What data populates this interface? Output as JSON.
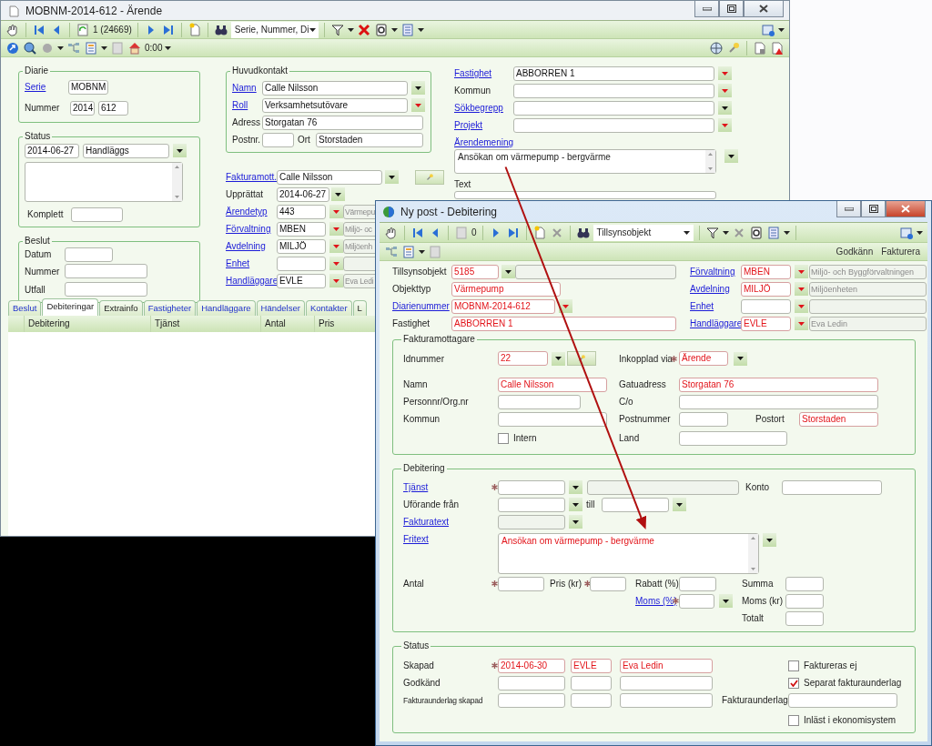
{
  "arende_window": {
    "title": "MOBNM-2014-612 - Ärende",
    "toolbar": {
      "record": "1 (24669)",
      "search": "Serie, Nummer, Di",
      "time": "0:00"
    },
    "diarie": {
      "legend": "Diarie",
      "fields": [
        {
          "label": "Serie",
          "link": true,
          "values": [
            "MOBNM"
          ]
        },
        {
          "label": "Nummer",
          "link": false,
          "values": [
            "2014",
            "612"
          ]
        }
      ]
    },
    "status": {
      "legend": "Status",
      "date": "2014-06-27",
      "state": "Handläggs",
      "komplett": "Komplett"
    },
    "beslut": {
      "legend": "Beslut",
      "fields": [
        {
          "label": "Datum",
          "link": false
        },
        {
          "label": "Nummer",
          "link": false
        },
        {
          "label": "Utfall",
          "link": false
        }
      ]
    },
    "huvudkontakt": {
      "legend": "Huvudkontakt",
      "fields": [
        {
          "label": "Namn",
          "link": true,
          "value": "Calle Nilsson",
          "arrow_required": false
        },
        {
          "label": "Roll",
          "link": true,
          "value": "Verksamhetsutövare",
          "arrow_required": true
        },
        {
          "label": "Adress",
          "link": false,
          "value": "Storgatan 76"
        },
        {
          "label": "Postnr.",
          "link": false
        },
        {
          "label": "Ort",
          "link": false,
          "value": "Storstaden"
        }
      ]
    },
    "case_fields": [
      {
        "label": "Fakturamott.",
        "link": true,
        "value": "Calle Nilsson",
        "arrow_required": false,
        "lookup": true
      },
      {
        "label": "Upprättat",
        "link": false,
        "value": "2014-06-27",
        "arrow_required": false
      },
      {
        "label": "Ärendetyp",
        "link": true,
        "value": "443",
        "arrow_required": true,
        "companion": true,
        "note": "Värmepu"
      },
      {
        "label": "Förvaltning",
        "link": true,
        "value": "MBEN",
        "arrow_required": true,
        "companion": true,
        "note": "Miljö- oc"
      },
      {
        "label": "Avdelning",
        "link": true,
        "value": "MILJÖ",
        "arrow_required": true,
        "companion": true,
        "note": "Miljöenh"
      },
      {
        "label": "Enhet",
        "link": true,
        "arrow_required": true,
        "companion": true
      },
      {
        "label": "Handläggare",
        "link": true,
        "value": "EVLE",
        "arrow_required": true,
        "companion": true,
        "note": "Eva Ledi"
      }
    ],
    "property_fields": [
      {
        "label": "Fastighet",
        "link": true,
        "value": "ABBORREN 1",
        "arrow_required": true
      },
      {
        "label": "Kommun",
        "link": false,
        "arrow_required": true
      },
      {
        "label": "Sökbegrepp",
        "link": true,
        "arrow_required": false
      },
      {
        "label": "Projekt",
        "link": true,
        "arrow_required": true
      }
    ],
    "arendemening": {
      "label": "Ärendemening",
      "link": true,
      "value": "Ansökan om värmepump - bergvärme",
      "arrow_required": false
    },
    "text_label": "Text",
    "tabs": [
      {
        "label": "Beslut",
        "has_data": true,
        "selected": false
      },
      {
        "label": "Debiteringar",
        "has_data": false,
        "selected": true
      },
      {
        "label": "Extrainfo",
        "has_data": false,
        "selected": false
      },
      {
        "label": "Fastigheter",
        "has_data": true,
        "selected": false
      },
      {
        "label": "Handläggare",
        "has_data": true,
        "selected": false
      },
      {
        "label": "Händelser",
        "has_data": true,
        "selected": false
      },
      {
        "label": "Kontakter",
        "has_data": true,
        "selected": false
      },
      {
        "label": "L",
        "has_data": false,
        "selected": false
      }
    ],
    "table": {
      "columns": [
        "Debitering",
        "Tjänst",
        "Antal",
        "Pris"
      ]
    }
  },
  "debitering_window": {
    "title": "Ny post - Debitering",
    "toolbar": {
      "record": "0",
      "search": "Tillsynsobjekt",
      "actions": [
        "Godkänn",
        "Fakturera"
      ]
    },
    "object_fields": [
      {
        "label": "Tillsynsobjekt",
        "link": false,
        "value": "5185",
        "required": true,
        "arrow_required": false,
        "companion": true
      },
      {
        "label": "Objekttyp",
        "link": false,
        "value": "Värmepump",
        "required": true
      },
      {
        "label": "Diarienummer",
        "link": true,
        "value": "MOBNM-2014-612",
        "required": true,
        "arrow_required": true
      },
      {
        "label": "Fastighet",
        "link": false,
        "value": "ABBORREN 1",
        "required": true
      }
    ],
    "org_fields": [
      {
        "label": "Förvaltning",
        "link": true,
        "value": "MBEN",
        "required": true,
        "arrow_required": true,
        "companion": true,
        "note": "Miljö- och Byggförvaltningen"
      },
      {
        "label": "Avdelning",
        "link": true,
        "value": "MILJÖ",
        "required": true,
        "arrow_required": true,
        "companion": true,
        "note": "Miljöenheten"
      },
      {
        "label": "Enhet",
        "link": true,
        "required": false,
        "arrow_required": true,
        "companion": true
      },
      {
        "label": "Handläggare",
        "link": true,
        "value": "EVLE",
        "required": true,
        "arrow_required": true,
        "companion": true,
        "note": "Eva Ledin"
      }
    ],
    "fakturamottagare": {
      "legend": "Fakturamottagare",
      "idnummer": {
        "label": "Idnummer",
        "value": "22",
        "required": true,
        "arrow_required": false,
        "lookup": true
      },
      "inkopplad": {
        "label": "Inkopplad via",
        "value": "Ärende",
        "required": true,
        "star": true,
        "arrow_required": false
      },
      "namn": {
        "label": "Namn",
        "value": "Calle Nilsson",
        "required": true
      },
      "gatuadress": {
        "label": "Gatuadress",
        "value": "Storgatan 76",
        "required": true
      },
      "personnr": {
        "label": "Personnr/Org.nr"
      },
      "co": {
        "label": "C/o"
      },
      "kommun": {
        "label": "Kommun"
      },
      "postnummer": {
        "label": "Postnummer"
      },
      "postort": {
        "label": "Postort",
        "value": "Storstaden",
        "required": true
      },
      "intern": {
        "label": "Intern",
        "checked": false
      },
      "land": {
        "label": "Land"
      }
    },
    "debitering": {
      "legend": "Debitering",
      "tjanst": {
        "label": "Tjänst",
        "link": true,
        "star": true,
        "arrow_required": false,
        "companion": true
      },
      "konto": {
        "label": "Konto"
      },
      "utforande": {
        "label": "Uförande från",
        "arrow_required": false
      },
      "till": {
        "label": "till",
        "arrow_required": false
      },
      "fakturatext": {
        "label": "Fakturatext",
        "link": true,
        "disabled": true,
        "arrow_required": false
      },
      "fritext": {
        "label": "Fritext",
        "link": true,
        "value": "Ansökan om värmepump - bergvärme",
        "required": true,
        "arrow_required": false
      },
      "antal": {
        "label": "Antal",
        "star": true
      },
      "pris": {
        "label": "Pris (kr)",
        "star": true
      },
      "rabatt": {
        "label": "Rabatt (%)"
      },
      "summa": {
        "label": "Summa"
      },
      "moms_procent": {
        "label": "Moms (%)",
        "link": true,
        "star": true,
        "arrow_required": false
      },
      "moms_kr": {
        "label": "Moms (kr)"
      },
      "totalt": {
        "label": "Totalt"
      }
    },
    "status": {
      "legend": "Status",
      "skapad": {
        "label": "Skapad",
        "star": true,
        "required": true,
        "values": [
          "2014-06-30",
          "EVLE",
          "Eva Ledin"
        ]
      },
      "godkand": {
        "label": "Godkänd"
      },
      "fakturaunderlag_skapad": {
        "label": "Fakturaunderlag skapad"
      },
      "fakturaunderlag": {
        "label": "Fakturaunderlag"
      },
      "checks": [
        {
          "label": "Faktureras ej",
          "checked": false
        },
        {
          "label": "Separat fakturaunderlag",
          "checked": true
        },
        {
          "label": "Inläst i ekonomisystem",
          "checked": false
        }
      ]
    }
  }
}
